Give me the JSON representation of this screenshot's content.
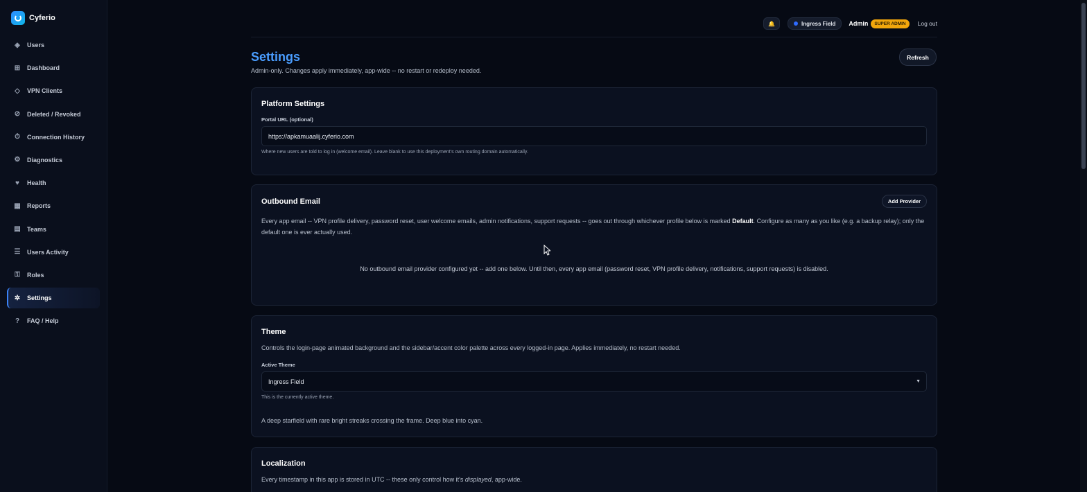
{
  "app": {
    "name": "Cyferio"
  },
  "sidebar": {
    "items": [
      {
        "label": "Users",
        "icon": "diamond-icon"
      },
      {
        "label": "Dashboard",
        "icon": "grid-icon"
      },
      {
        "label": "VPN Clients",
        "icon": "diamond-outline-icon"
      },
      {
        "label": "Deleted / Revoked",
        "icon": "ban-icon"
      },
      {
        "label": "Connection History",
        "icon": "stopwatch-icon"
      },
      {
        "label": "Diagnostics",
        "icon": "cog-icon"
      },
      {
        "label": "Health",
        "icon": "heart-icon"
      },
      {
        "label": "Reports",
        "icon": "table-icon"
      },
      {
        "label": "Teams",
        "icon": "list-box-icon"
      },
      {
        "label": "Users Activity",
        "icon": "lines-icon"
      },
      {
        "label": "Roles",
        "icon": "id-icon"
      },
      {
        "label": "Settings",
        "icon": "gear-icon",
        "active": true
      },
      {
        "label": "FAQ / Help",
        "icon": "question-icon"
      }
    ]
  },
  "header": {
    "theme_chip": "Ingress Field",
    "user_name": "Admin",
    "role_badge": "SUPER ADMIN",
    "logout": "Log out"
  },
  "page": {
    "title": "Settings",
    "subtitle": "Admin-only. Changes apply immediately, app-wide -- no restart or redeploy needed.",
    "refresh": "Refresh"
  },
  "platform": {
    "title": "Platform Settings",
    "portal_label": "Portal URL (optional)",
    "portal_value": "https://apkamuaalij.cyferio.com",
    "portal_hint": "Where new users are told to log in (welcome email). Leave blank to use this deployment's own routing domain automatically."
  },
  "email": {
    "title": "Outbound Email",
    "add_provider": "Add Provider",
    "desc_before": "Every app email -- VPN profile delivery, password reset, user welcome emails, admin notifications, support requests -- goes out through whichever profile below is marked ",
    "desc_bold": "Default",
    "desc_after": ". Configure as many as you like (e.g. a backup relay); only the default one is ever actually used.",
    "empty": "No outbound email provider configured yet -- add one below. Until then, every app email (password reset, VPN profile delivery, notifications, support requests) is disabled."
  },
  "theme": {
    "title": "Theme",
    "desc": "Controls the login-page animated background and the sidebar/accent color palette across every logged-in page. Applies immediately, no restart needed.",
    "active_label": "Active Theme",
    "selected": "Ingress Field",
    "hint": "This is the currently active theme.",
    "theme_desc": "A deep starfield with rare bright streaks crossing the frame. Deep blue into cyan."
  },
  "localization": {
    "title": "Localization",
    "desc_before": "Every timestamp in this app is stored in UTC -- these only control how it's ",
    "desc_italic": "displayed",
    "desc_after": ", app-wide."
  },
  "colors": {
    "accent": "#4a9dff",
    "badge": "#f2a60c",
    "background": "#060a14"
  }
}
